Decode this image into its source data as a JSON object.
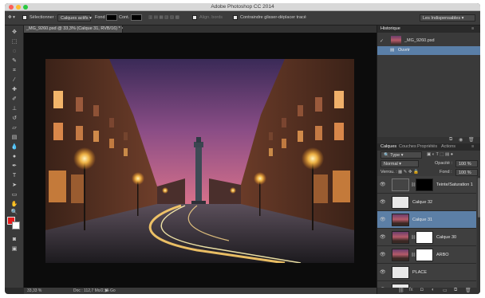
{
  "window": {
    "title": "Adobe Photoshop CC 2014"
  },
  "options_bar": {
    "select_label": "Sélectionner :",
    "select_value": "Calques actifs",
    "fill_label": "Fond :",
    "contour_label": "Cont. :",
    "align_label": "Align. bords",
    "constrain_label": "Contraindre glisser-déplacer tracé",
    "workspace": "Les Indispensables"
  },
  "document": {
    "tab_title": "_MG_9260.psd @ 33,3% (Calque 31, RVB/16) *",
    "zoom": "33,33 %",
    "doc_info": "Doc : 112,7 Mo/2,95 Go"
  },
  "history": {
    "tab": "Historique",
    "snapshot": "_MG_9260.psd",
    "state": "Ouvrir"
  },
  "layers_panel": {
    "tabs": [
      "Calques",
      "Couches",
      "Propriétés",
      "Actions"
    ],
    "filter": "Type",
    "blend_mode": "Normal",
    "opacity_label": "Opacité :",
    "opacity": "100 %",
    "lock_label": "Verrou. :",
    "fill_label": "Fond :",
    "fill": "100 %",
    "layers": [
      {
        "name": "Teinte/Saturation 1",
        "thumb": "adj",
        "mask": "black",
        "selected": false
      },
      {
        "name": "Calque 32",
        "thumb": "blank",
        "mask": "",
        "selected": false
      },
      {
        "name": "Calque 31",
        "thumb": "photo",
        "mask": "",
        "selected": true
      },
      {
        "name": "Calque 30",
        "thumb": "photo",
        "mask": "white",
        "selected": false
      },
      {
        "name": "ARBO",
        "thumb": "photo",
        "mask": "white",
        "selected": false
      },
      {
        "name": "PLACE",
        "thumb": "blank",
        "mask": "",
        "selected": false
      },
      {
        "name": "1",
        "thumb": "blank",
        "mask": "",
        "selected": false
      }
    ]
  },
  "colors": {
    "foreground": "#e61b1b",
    "background": "#ffffff",
    "selection": "#5c7fa6"
  }
}
